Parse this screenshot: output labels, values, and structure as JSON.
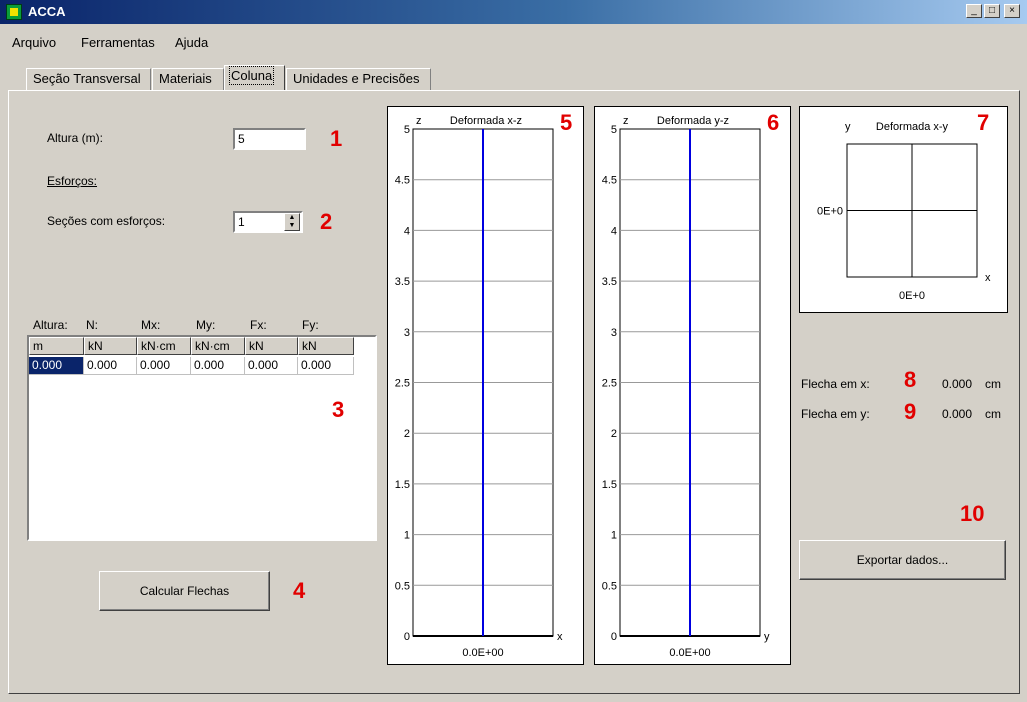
{
  "window": {
    "title": "ACCA",
    "minimize": "_",
    "maximize": "□",
    "close": "×"
  },
  "menu": [
    "Arquivo",
    "Ferramentas",
    "Ajuda"
  ],
  "tabs": [
    {
      "label": "Seção Transversal"
    },
    {
      "label": "Materiais"
    },
    {
      "label": "Coluna"
    },
    {
      "label": "Unidades e Precisões"
    }
  ],
  "coluna": {
    "altura_label": "Altura (m):",
    "altura_value": "5",
    "esforcos_label": "Esforços:",
    "secoes_label": "Seções com esforços:",
    "secoes_value": "1",
    "grid": {
      "top_labels": [
        "Altura:",
        "N:",
        "Mx:",
        "My:",
        "Fx:",
        "Fy:"
      ],
      "units": [
        "m",
        "kN",
        "kN·cm",
        "kN·cm",
        "kN",
        "kN"
      ],
      "rows": [
        [
          "0.000",
          "0.000",
          "0.000",
          "0.000",
          "0.000",
          "0.000"
        ]
      ]
    },
    "calc_button": "Calcular Flechas",
    "export_button": "Exportar dados...",
    "flecha_x_label": "Flecha em x:",
    "flecha_x_value": "0.000",
    "flecha_x_unit": "cm",
    "flecha_y_label": "Flecha em y:",
    "flecha_y_value": "0.000",
    "flecha_y_unit": "cm"
  },
  "plots": {
    "xz": {
      "title": "Deformada x-z",
      "vaxis": "z",
      "haxis": "x",
      "bottom_tick": "0.0E+00"
    },
    "yz": {
      "title": "Deformada y-z",
      "vaxis": "z",
      "haxis": "y",
      "bottom_tick": "0.0E+00"
    },
    "xy": {
      "title": "Deformada x-y",
      "vaxis": "y",
      "haxis": "x",
      "left_tick": "0E+0",
      "bottom_tick": "0E+0"
    },
    "y_ticks": [
      "5",
      "4.5",
      "4",
      "3.5",
      "3",
      "2.5",
      "2",
      "1.5",
      "1",
      "0.5",
      "0"
    ]
  },
  "annotations": [
    "1",
    "2",
    "3",
    "4",
    "5",
    "6",
    "7",
    "8",
    "9",
    "10"
  ],
  "colors": {
    "deformed_line": "#0000e0",
    "annotation": "#e10000",
    "selection": "#0a246a"
  },
  "chart_data": [
    {
      "type": "line",
      "title": "Deformada x-z",
      "xlabel": "x",
      "ylabel": "z",
      "ylim": [
        0,
        5
      ],
      "series": [
        {
          "x": [
            0,
            0
          ],
          "y": [
            0,
            5
          ]
        }
      ]
    },
    {
      "type": "line",
      "title": "Deformada y-z",
      "xlabel": "y",
      "ylabel": "z",
      "ylim": [
        0,
        5
      ],
      "series": [
        {
          "x": [
            0,
            0
          ],
          "y": [
            0,
            5
          ]
        }
      ]
    }
  ]
}
